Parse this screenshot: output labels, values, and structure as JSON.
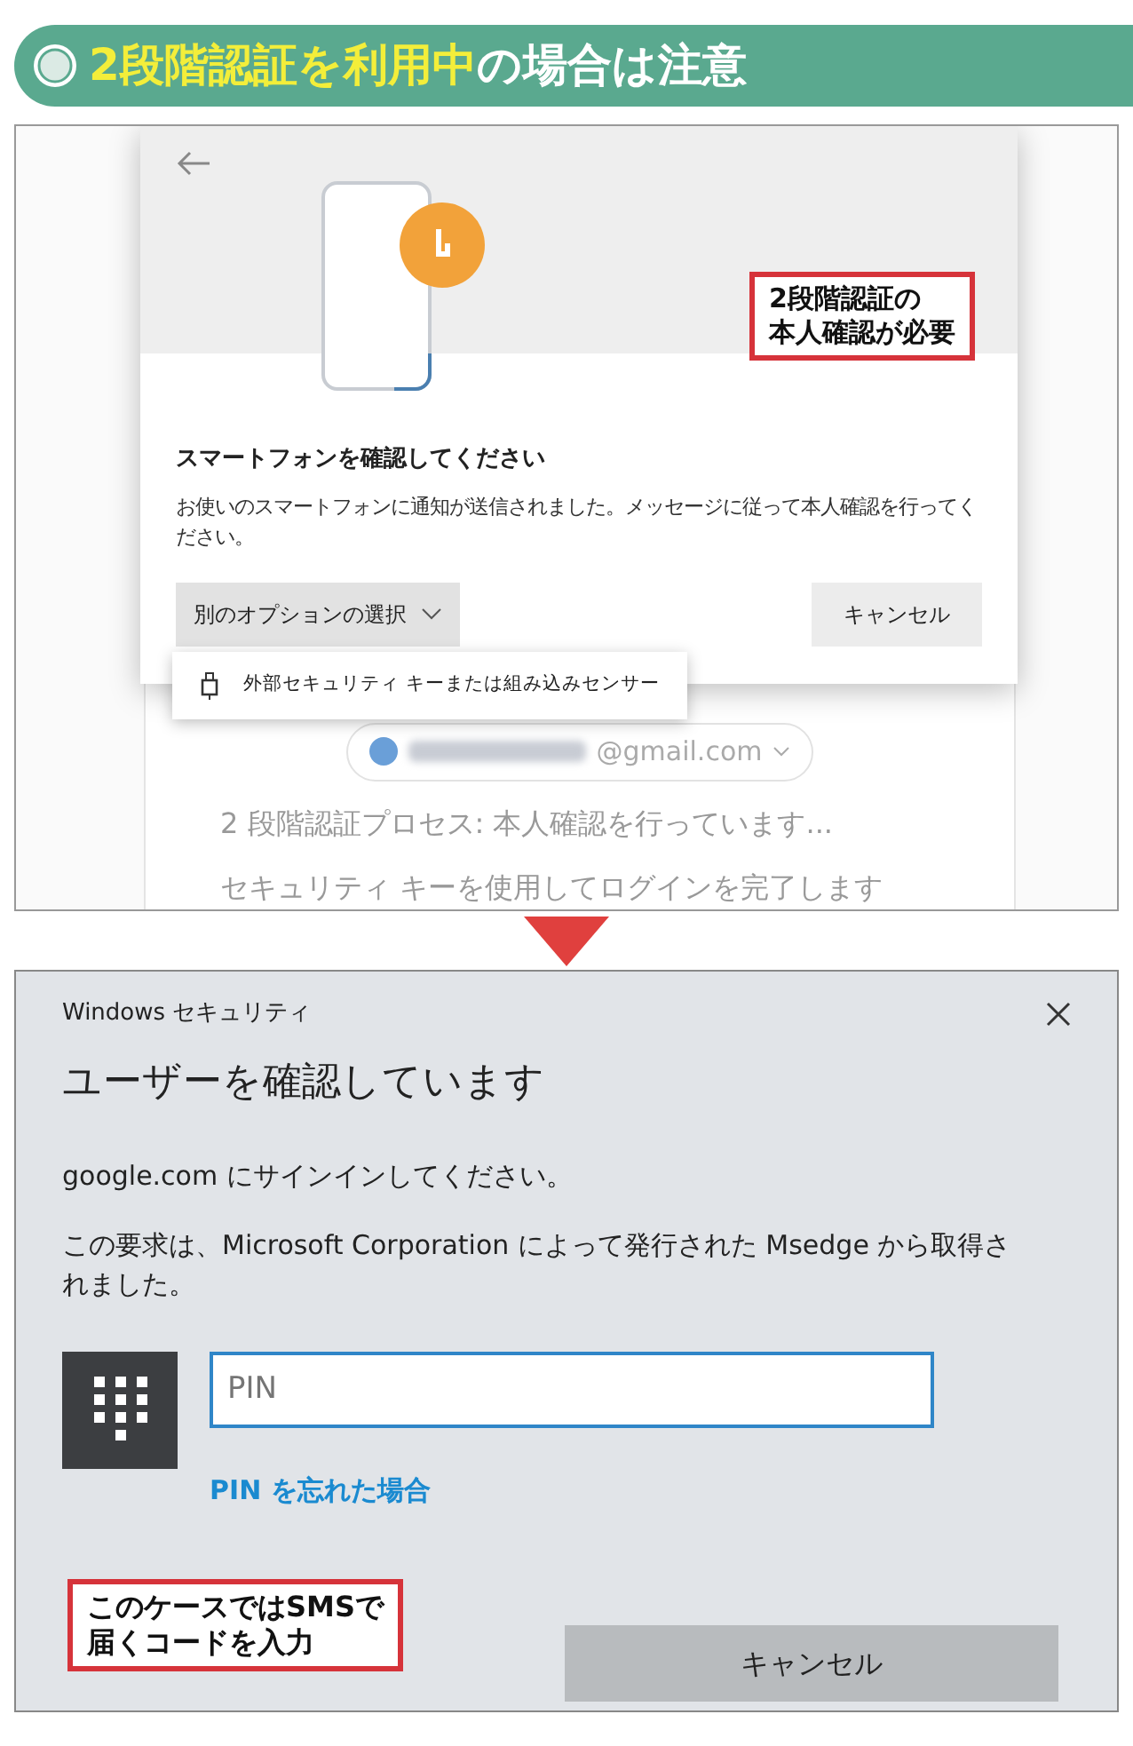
{
  "banner": {
    "highlight": "2段階認証を利用中",
    "rest": "の場合は注意"
  },
  "browser_dialog": {
    "title": "スマートフォンを確認してください",
    "message": "お使いのスマートフォンに通知が送信されました。メッセージに従って本人確認を行ってください。",
    "options_button": "別のオプションの選択",
    "cancel_button": "キャンセル",
    "menu_items": [
      {
        "label": "外部セキュリティ キーまたは組み込みセンサー"
      }
    ],
    "callout": [
      "2段階認証の",
      "本人確認が必要"
    ]
  },
  "background_page": {
    "account": "@gmail.com",
    "status": "2 段階認証プロセス: 本人確認を行っています...",
    "hint": "セキュリティ キーを使用してログインを完了します"
  },
  "windows_dialog": {
    "window_title": "Windows セキュリティ",
    "heading": "ユーザーを確認しています",
    "sign_in_text": "google.com にサインインしてください。",
    "request_text": "この要求は、Microsoft Corporation によって発行された Msedge から取得されました。",
    "pin_field": {
      "placeholder": "PIN"
    },
    "forgot_link": "PIN を忘れた場合",
    "cancel_button": "キャンセル",
    "callout": [
      "このケースではSMSで",
      "届くコードを入力"
    ]
  }
}
